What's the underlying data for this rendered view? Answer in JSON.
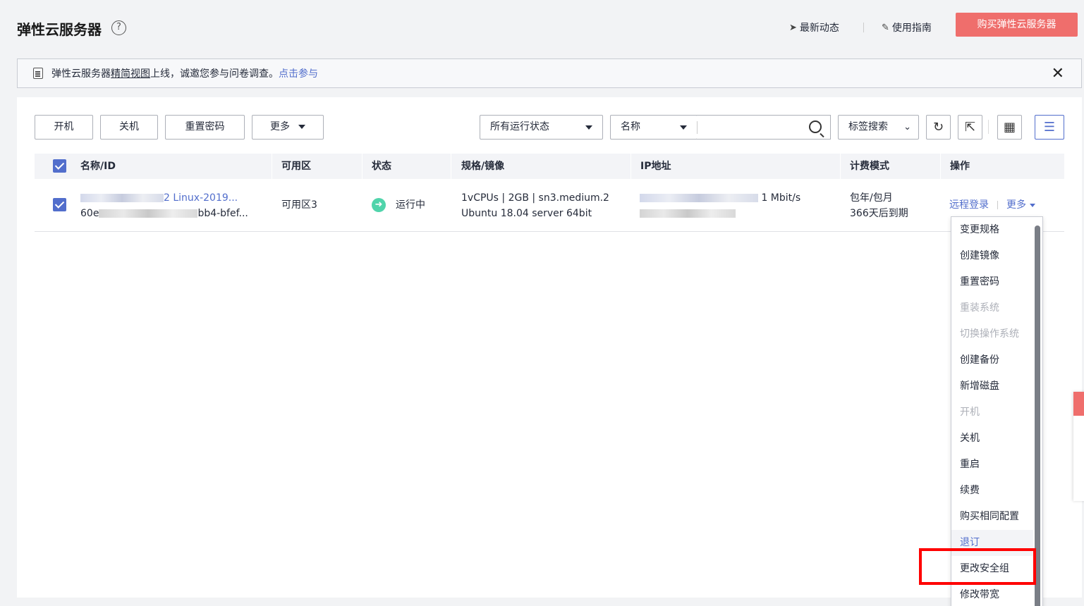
{
  "header": {
    "title": "弹性云服务器",
    "help_glyph": "?",
    "news_label": "最新动态",
    "guide_label": "使用指南",
    "buy_label": "购买弹性云服务器"
  },
  "notice": {
    "text_prefix": "弹性云服务器",
    "text_underlined": "精简视图",
    "text_suffix": "上线，诚邀您参与问卷调查。",
    "link": "点击参与",
    "close_glyph": "✕"
  },
  "toolbar": {
    "start": "开机",
    "stop": "关机",
    "reset_pwd": "重置密码",
    "more": "更多",
    "status_filter": "所有运行状态",
    "search_field": "名称",
    "tag_search": "标签搜索"
  },
  "table": {
    "headers": [
      "名称/ID",
      "可用区",
      "状态",
      "规格/镜像",
      "IP地址",
      "计费模式",
      "操作"
    ],
    "row": {
      "name_visible": "2 Linux-2019...",
      "id_prefix": "60e",
      "id_suffix": "bb4-bfef...",
      "az": "可用区3",
      "status": "运行中",
      "spec": "1vCPUs | 2GB | sn3.medium.2",
      "image": "Ubuntu 18.04 server 64bit",
      "bandwidth": "1 Mbit/s",
      "billing": "包年/包月",
      "expiry": "366天后到期",
      "op_remote": "远程登录",
      "op_more": "更多"
    }
  },
  "menu": {
    "items": [
      {
        "label": "变更规格",
        "state": "enabled"
      },
      {
        "label": "创建镜像",
        "state": "enabled"
      },
      {
        "label": "重置密码",
        "state": "enabled"
      },
      {
        "label": "重装系统",
        "state": "disabled"
      },
      {
        "label": "切换操作系统",
        "state": "disabled"
      },
      {
        "label": "创建备份",
        "state": "enabled"
      },
      {
        "label": "新增磁盘",
        "state": "enabled"
      },
      {
        "label": "开机",
        "state": "disabled"
      },
      {
        "label": "关机",
        "state": "enabled"
      },
      {
        "label": "重启",
        "state": "enabled"
      },
      {
        "label": "续费",
        "state": "enabled"
      },
      {
        "label": "购买相同配置",
        "state": "enabled"
      },
      {
        "label": "退订",
        "state": "hover"
      },
      {
        "label": "更改安全组",
        "state": "enabled"
      },
      {
        "label": "修改带宽",
        "state": "enabled"
      }
    ]
  },
  "colors": {
    "accent": "#526ecc",
    "buy_button": "#ef6e6c",
    "status_running": "#50d4ab",
    "highlight_box": "#ff0000"
  }
}
